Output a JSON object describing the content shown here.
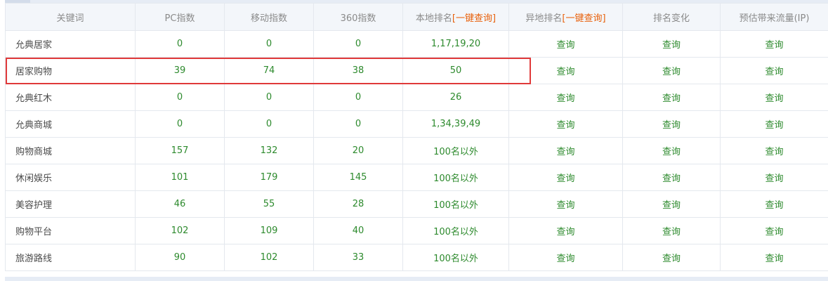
{
  "table": {
    "headers": {
      "keyword": "关键词",
      "pc_index": "PC指数",
      "mobile_index": "移动指数",
      "index_360": "360指数",
      "local_rank": "本地排名",
      "remote_rank": "异地排名",
      "one_click_query": "[一键查询]",
      "rank_change": "排名变化",
      "estimated_traffic": "预估带来流量(IP)"
    },
    "query_label": "查询",
    "rows": [
      {
        "keyword": "允典居家",
        "pc": "0",
        "mobile": "0",
        "i360": "0",
        "local_rank": "1,17,19,20"
      },
      {
        "keyword": "居家购物",
        "pc": "39",
        "mobile": "74",
        "i360": "38",
        "local_rank": "50"
      },
      {
        "keyword": "允典红木",
        "pc": "0",
        "mobile": "0",
        "i360": "0",
        "local_rank": "26"
      },
      {
        "keyword": "允典商城",
        "pc": "0",
        "mobile": "0",
        "i360": "0",
        "local_rank": "1,34,39,49"
      },
      {
        "keyword": "购物商城",
        "pc": "157",
        "mobile": "132",
        "i360": "20",
        "local_rank": "100名以外"
      },
      {
        "keyword": "休闲娱乐",
        "pc": "101",
        "mobile": "179",
        "i360": "145",
        "local_rank": "100名以外"
      },
      {
        "keyword": "美容护理",
        "pc": "46",
        "mobile": "55",
        "i360": "28",
        "local_rank": "100名以外"
      },
      {
        "keyword": "购物平台",
        "pc": "102",
        "mobile": "109",
        "i360": "40",
        "local_rank": "100名以外"
      },
      {
        "keyword": "旅游路线",
        "pc": "90",
        "mobile": "102",
        "i360": "33",
        "local_rank": "100名以外"
      }
    ]
  },
  "colors": {
    "value_green": "#2d8a2d",
    "link_orange": "#e8600a",
    "highlight_red": "#e03a3a",
    "header_bg": "#f3f6fa"
  }
}
